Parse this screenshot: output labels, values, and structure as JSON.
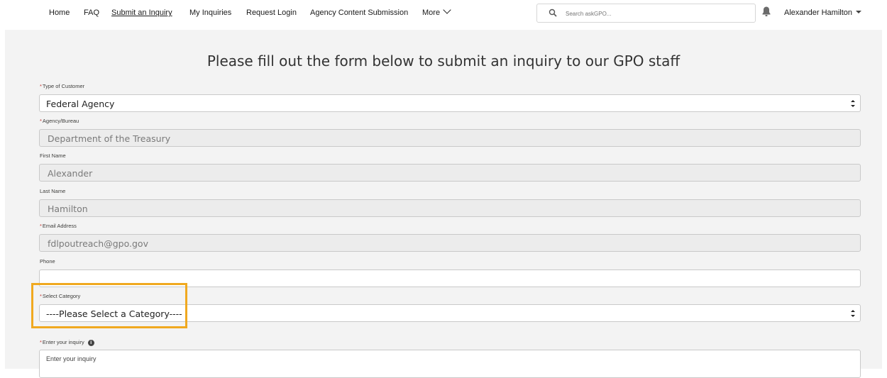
{
  "nav": {
    "items": [
      {
        "label": "Home"
      },
      {
        "label": "FAQ"
      },
      {
        "label": "Submit an Inquiry"
      },
      {
        "label": "My Inquiries"
      },
      {
        "label": "Request Login"
      },
      {
        "label": "Agency Content Submission"
      },
      {
        "label": "More"
      }
    ],
    "search_placeholder": "Search askGPO...",
    "user_name": "Alexander Hamilton"
  },
  "page": {
    "title": "Please fill out the form below to submit an inquiry to our GPO staff"
  },
  "form": {
    "required_marker": "*",
    "customer_type": {
      "label": "Type of Customer",
      "value": "Federal Agency"
    },
    "agency": {
      "label": "Agency/Bureau",
      "value": "Department of the Treasury"
    },
    "first_name": {
      "label": "First Name",
      "value": "Alexander"
    },
    "last_name": {
      "label": "Last Name",
      "value": "Hamilton"
    },
    "email": {
      "label": "Email Address",
      "value": "fdlpoutreach@gpo.gov"
    },
    "phone": {
      "label": "Phone",
      "value": ""
    },
    "category": {
      "label": "Select Category",
      "value": "----Please Select a Category----"
    },
    "inquiry": {
      "label": "Enter your inquiry",
      "placeholder": "Enter your inquiry",
      "info_glyph": "i"
    }
  },
  "colors": {
    "highlight": "#f0a920",
    "required": "#c23934"
  }
}
